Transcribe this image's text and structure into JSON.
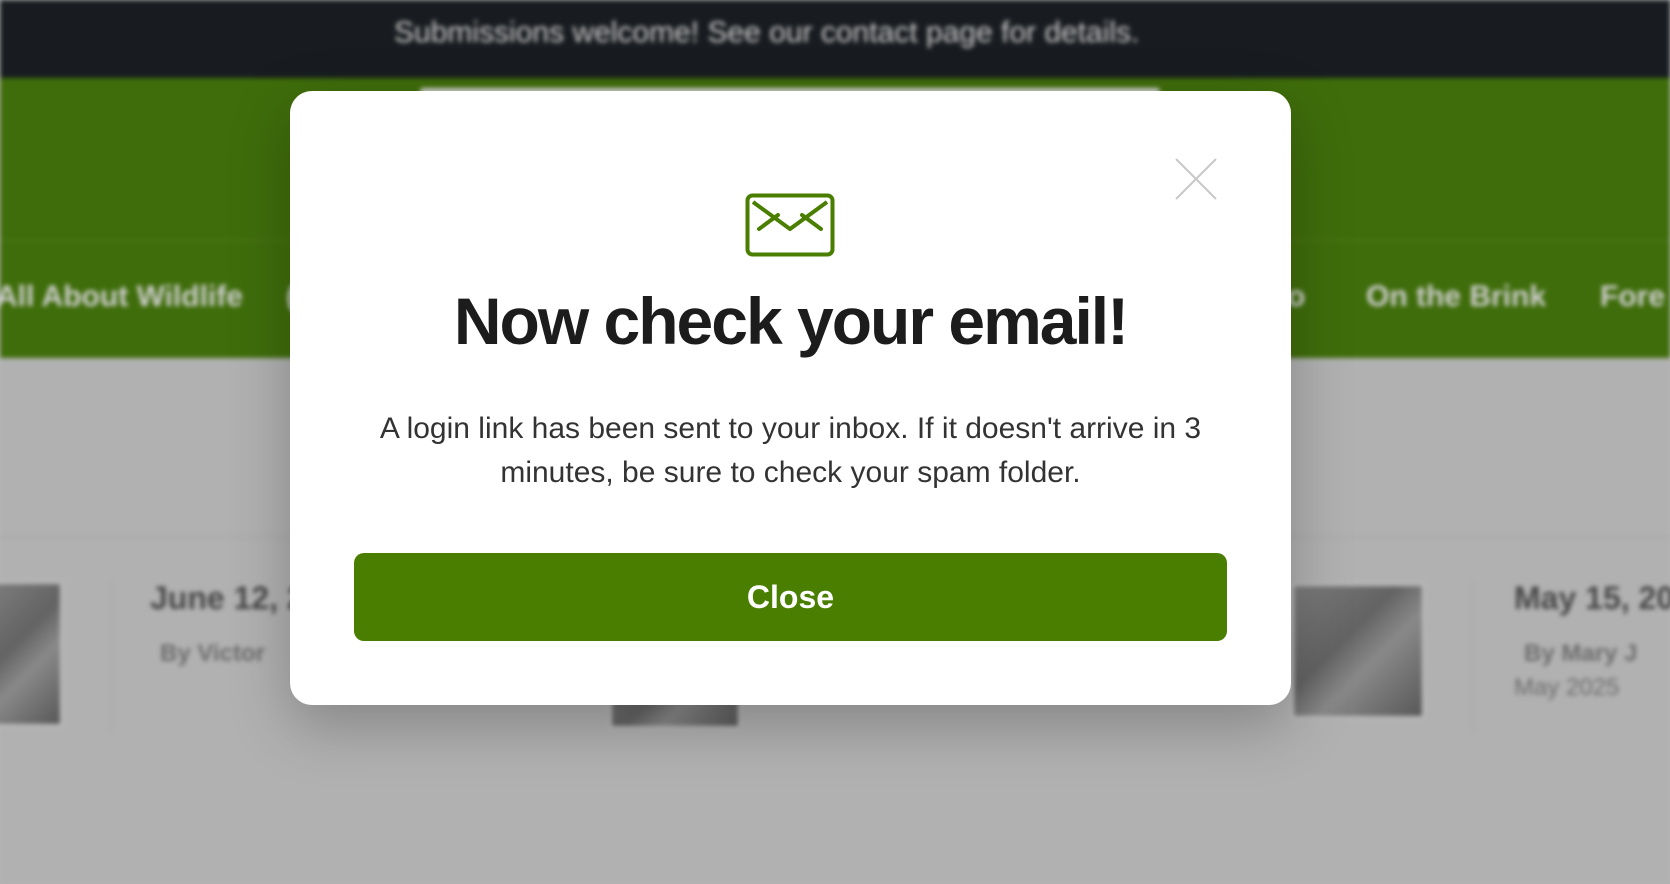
{
  "announcement": "Submissions welcome! See our contact page for details.",
  "nav": {
    "items": [
      "All About Wildlife",
      "On the Brink",
      "Fore"
    ],
    "partial_left": "(",
    "partial_right": "o"
  },
  "cards": [
    {
      "date": "June 12, 2",
      "byline": "By Victor"
    },
    {
      "date": "May 15, 20",
      "byline": "By Mary J",
      "extra": "May 2025"
    }
  ],
  "modal": {
    "icon": "envelope-icon",
    "title": "Now check your email!",
    "body": "A login link has been sent to your inbox. If it doesn't arrive in 3 minutes, be sure to check your spam folder.",
    "close_label": "Close",
    "close_icon": "close-icon"
  },
  "colors": {
    "accent": "#4a7e00",
    "header_green": "#407800",
    "announcement_bg": "#11151a"
  }
}
